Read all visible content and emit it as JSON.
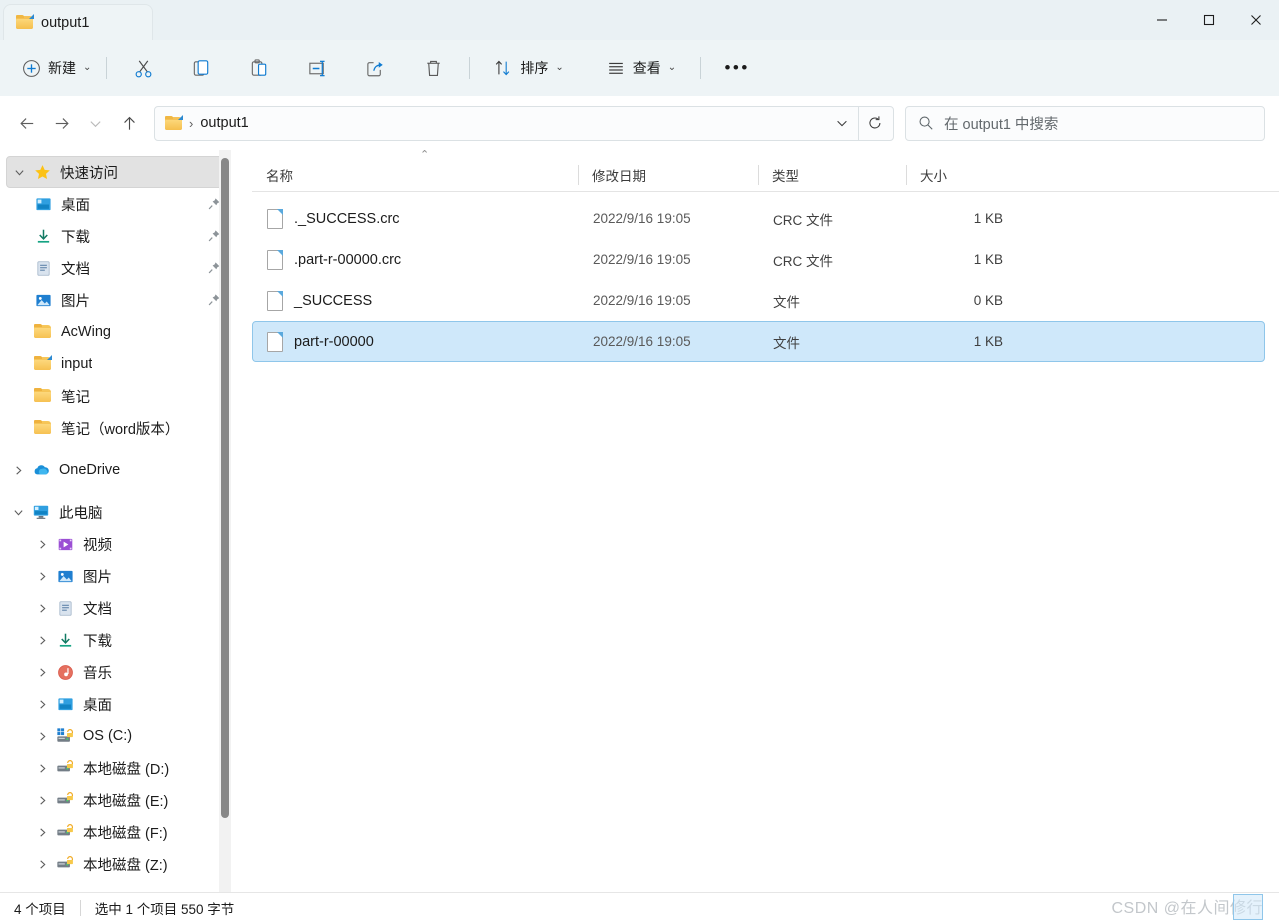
{
  "window": {
    "tab_title": "output1",
    "minimize_label": "最小化",
    "maximize_label": "最大化",
    "close_label": "关闭"
  },
  "toolbar": {
    "new_label": "新建",
    "sort_label": "排序",
    "view_label": "查看",
    "more_label": "...",
    "icons": {
      "new": "plus-circle-icon",
      "cut": "scissors-icon",
      "copy": "copy-icon",
      "paste": "paste-icon",
      "rename": "rename-icon",
      "share": "share-icon",
      "delete": "trash-icon",
      "sort": "sort-arrows-icon",
      "view": "list-lines-icon",
      "more": "ellipsis-icon"
    }
  },
  "address": {
    "back_icon": "arrow-left-icon",
    "forward_icon": "arrow-right-icon",
    "recent_icon": "chevron-down-icon",
    "up_icon": "arrow-up-icon",
    "folder_icon": "folder-shortcut-icon",
    "crumb_separator": "›",
    "path_label": "output1",
    "dropdown_icon": "chevron-down-icon",
    "refresh_icon": "refresh-icon"
  },
  "search": {
    "icon": "search-icon",
    "placeholder": "在 output1 中搜索"
  },
  "sidebar": {
    "groups": [
      {
        "label": "快速访问",
        "icon": "star-icon",
        "expander": "chevron-down-icon",
        "selected": true,
        "items": [
          {
            "label": "桌面",
            "icon": "desktop-icon",
            "pinned": true
          },
          {
            "label": "下载",
            "icon": "downloads-icon",
            "pinned": true
          },
          {
            "label": "文档",
            "icon": "documents-icon",
            "pinned": true
          },
          {
            "label": "图片",
            "icon": "pictures-icon",
            "pinned": true
          },
          {
            "label": "AcWing",
            "icon": "folder-icon",
            "pinned": false
          },
          {
            "label": "input",
            "icon": "folder-shortcut-icon",
            "pinned": false
          },
          {
            "label": "笔记",
            "icon": "folder-icon",
            "pinned": false
          },
          {
            "label": "笔记（word版本）",
            "icon": "folder-icon",
            "pinned": false
          }
        ]
      },
      {
        "label": "OneDrive",
        "icon": "onedrive-cloud-icon",
        "expander": "chevron-right-icon",
        "selected": false,
        "items": []
      },
      {
        "label": "此电脑",
        "icon": "this-pc-icon",
        "expander": "chevron-down-icon",
        "selected": false,
        "items": [
          {
            "label": "视频",
            "icon": "videos-icon",
            "expander": "chevron-right-icon"
          },
          {
            "label": "图片",
            "icon": "pictures-icon",
            "expander": "chevron-right-icon"
          },
          {
            "label": "文档",
            "icon": "documents-icon",
            "expander": "chevron-right-icon"
          },
          {
            "label": "下载",
            "icon": "downloads-icon",
            "expander": "chevron-right-icon"
          },
          {
            "label": "音乐",
            "icon": "music-icon",
            "expander": "chevron-right-icon"
          },
          {
            "label": "桌面",
            "icon": "desktop-icon",
            "expander": "chevron-right-icon"
          },
          {
            "label": "OS (C:)",
            "icon": "os-drive-icon",
            "expander": "chevron-right-icon"
          },
          {
            "label": "本地磁盘 (D:)",
            "icon": "drive-icon",
            "expander": "chevron-right-icon"
          },
          {
            "label": "本地磁盘 (E:)",
            "icon": "drive-icon",
            "expander": "chevron-right-icon"
          },
          {
            "label": "本地磁盘 (F:)",
            "icon": "drive-icon",
            "expander": "chevron-right-icon"
          },
          {
            "label": "本地磁盘 (Z:)",
            "icon": "drive-icon",
            "expander": "chevron-right-icon"
          }
        ]
      }
    ]
  },
  "filelist": {
    "columns": {
      "name": "名称",
      "date": "修改日期",
      "type": "类型",
      "size": "大小"
    },
    "sort_indicator": "⌃",
    "rows": [
      {
        "name": "._SUCCESS.crc",
        "date": "2022/9/16 19:05",
        "type": "CRC 文件",
        "size": "1 KB",
        "selected": false
      },
      {
        "name": ".part-r-00000.crc",
        "date": "2022/9/16 19:05",
        "type": "CRC 文件",
        "size": "1 KB",
        "selected": false
      },
      {
        "name": "_SUCCESS",
        "date": "2022/9/16 19:05",
        "type": "文件",
        "size": "0 KB",
        "selected": false
      },
      {
        "name": "part-r-00000",
        "date": "2022/9/16 19:05",
        "type": "文件",
        "size": "1 KB",
        "selected": true
      }
    ]
  },
  "statusbar": {
    "item_count": "4 个项目",
    "selection": "选中 1 个项目  550 字节"
  },
  "watermark": {
    "text": "CSDN @在人间修行"
  },
  "colors": {
    "titlebar_bg": "#eaf1f4",
    "toolbar_bg": "#eef4f6",
    "accent_blue": "#0f7bd1",
    "selection_bg": "#cfe8fa",
    "selection_border": "#8fc6ea",
    "folder_yellow": "#f6c152"
  }
}
